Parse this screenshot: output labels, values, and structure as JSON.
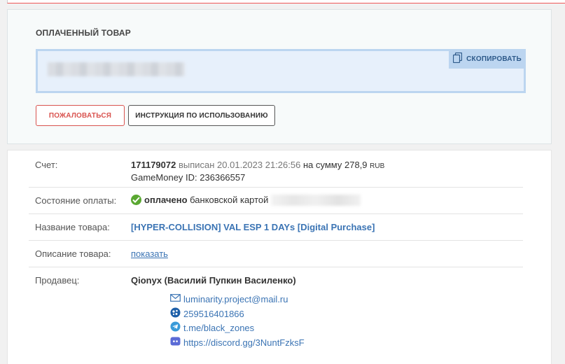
{
  "paid_section": {
    "title": "ОПЛАЧЕННЫЙ ТОВАР",
    "copy_label": "СКОПИРОВАТЬ",
    "complain_label": "ПОЖАЛОВАТЬСЯ",
    "instruction_label": "ИНСТРУКЦИЯ ПО ИСПОЛЬЗОВАНИЮ"
  },
  "invoice": {
    "label": "Счет:",
    "number": "171179072",
    "issued_text": "выписан 20.01.2023 21:26:56",
    "amount_prefix": "на сумму",
    "amount": "278,9",
    "currency": "RUB",
    "gamemoney_label": "GameMoney ID:",
    "gamemoney_id": "236366557"
  },
  "payment_status": {
    "label": "Состояние оплаты:",
    "status": "оплачено",
    "method": "банковской картой"
  },
  "product": {
    "label": "Название товара:",
    "name": "[HYPER-COLLISION] VAL ESP 1 DAYs [Digital Purchase]"
  },
  "description": {
    "label": "Описание товара:",
    "link": "показать"
  },
  "seller": {
    "label": "Продавец:",
    "name": "Qionyx (Василий Пупкин Василенко)",
    "email": "luminarity.project@mail.ru",
    "wmid": "259516401866",
    "telegram": "t.me/black_zones",
    "discord": "https://discord.gg/3NuntFzksF"
  },
  "colors": {
    "accent_blue": "#3b74b4",
    "danger": "#d9534f",
    "success": "#5aa832"
  },
  "icons": [
    "copy-icon",
    "check-circle-icon",
    "mail-icon",
    "webmoney-icon",
    "telegram-icon",
    "discord-icon"
  ]
}
